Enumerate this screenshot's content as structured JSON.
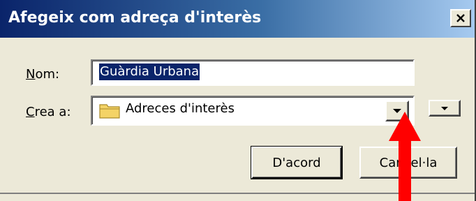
{
  "window": {
    "title": "Afegeix com adreça d'interès",
    "close_glyph": "×"
  },
  "form": {
    "name_label_accel": "N",
    "name_label_rest": "om:",
    "name_value": "Guàrdia Urbana",
    "create_label_accel": "C",
    "create_label_rest": "rea a:",
    "create_value": "Adreces d'interès"
  },
  "buttons": {
    "ok_label": "D'acord",
    "cancel_label": "Cancel·la"
  },
  "colors": {
    "title_start": "#0a246a",
    "title_end": "#a6caf0",
    "face": "#ece9d8",
    "selection": "#0a246a",
    "arrow": "#ff0000",
    "folder": "#f4d366"
  },
  "icons": {
    "close": "close-icon",
    "folder": "folder-icon",
    "combo_dropdown": "chevron-down-icon",
    "expand_dropdown": "chevron-down-icon",
    "annotation": "red-arrow-icon"
  }
}
